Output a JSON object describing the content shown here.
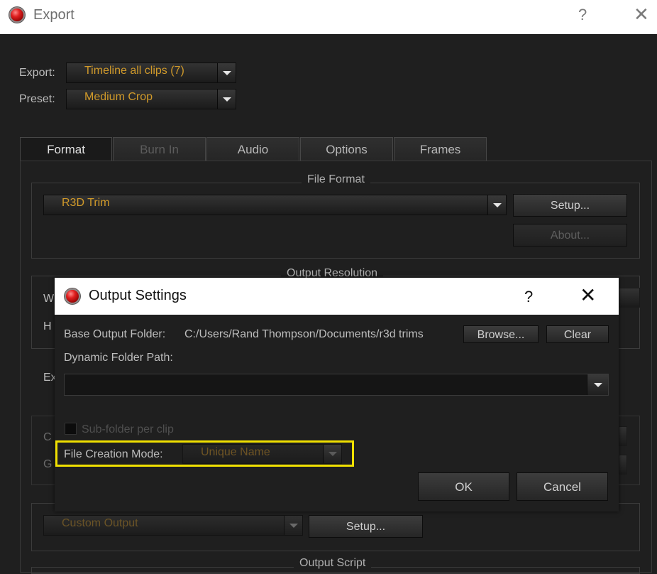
{
  "window": {
    "title": "Export",
    "help_label": "?",
    "close_label": "✕"
  },
  "export_row": {
    "label": "Export:",
    "value": "Timeline all clips (7)"
  },
  "preset_row": {
    "label": "Preset:",
    "value": "Medium Crop"
  },
  "tabs": [
    {
      "label": "Format",
      "state": "active"
    },
    {
      "label": "Burn In",
      "state": "disabled"
    },
    {
      "label": "Audio",
      "state": "normal"
    },
    {
      "label": "Options",
      "state": "normal"
    },
    {
      "label": "Frames",
      "state": "normal"
    }
  ],
  "file_format": {
    "group_title": "File Format",
    "value": "R3D Trim",
    "setup_label": "Setup...",
    "about_label": "About..."
  },
  "output_resolution": {
    "group_title": "Output Resolution",
    "partial_w": "W",
    "partial_h": "H"
  },
  "partial_labels": {
    "ex": "Ex",
    "c": "C",
    "g": "G"
  },
  "custom_output": {
    "value": "Custom Output",
    "setup_label": "Setup..."
  },
  "output_script": {
    "group_title": "Output Script"
  },
  "dialog": {
    "title": "Output Settings",
    "help_label": "?",
    "close_label": "✕",
    "base_folder_label": "Base Output Folder:",
    "base_folder_value": "C:/Users/Rand Thompson/Documents/r3d trims",
    "browse_label": "Browse...",
    "clear_label": "Clear",
    "dynamic_path_label": "Dynamic Folder Path:",
    "dynamic_path_value": "",
    "subfolder_label": "Sub-folder per clip",
    "creation_mode_label": "File Creation Mode:",
    "creation_mode_value": "Unique Name",
    "ok_label": "OK",
    "cancel_label": "Cancel"
  },
  "colors": {
    "accent_text": "#d19a2a",
    "highlight": "#f0e000",
    "background": "#1f1f1f"
  }
}
